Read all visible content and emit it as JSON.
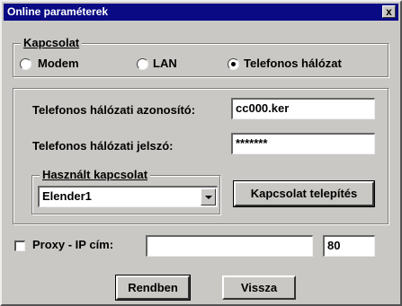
{
  "window": {
    "title": "Online paraméterek",
    "close_label": "x"
  },
  "connection_group": {
    "legend": "Kapcsolat",
    "options": [
      {
        "label": "Modem",
        "selected": false
      },
      {
        "label": "LAN",
        "selected": false
      },
      {
        "label": "Telefonos hálózat",
        "selected": true
      }
    ]
  },
  "network": {
    "id_label": "Telefonos hálózati azonosító:",
    "id_value": "cc000.ker",
    "password_label": "Telefonos hálózati jelszó:",
    "password_value": "*******"
  },
  "used_connection": {
    "legend": "Használt kapcsolat",
    "selected": "Elender1"
  },
  "install_button": "Kapcsolat telepítés",
  "proxy": {
    "checked": false,
    "label": "Proxy - IP cím:",
    "ip_value": "",
    "port_value": "80"
  },
  "buttons": {
    "ok": "Rendben",
    "back": "Vissza"
  }
}
